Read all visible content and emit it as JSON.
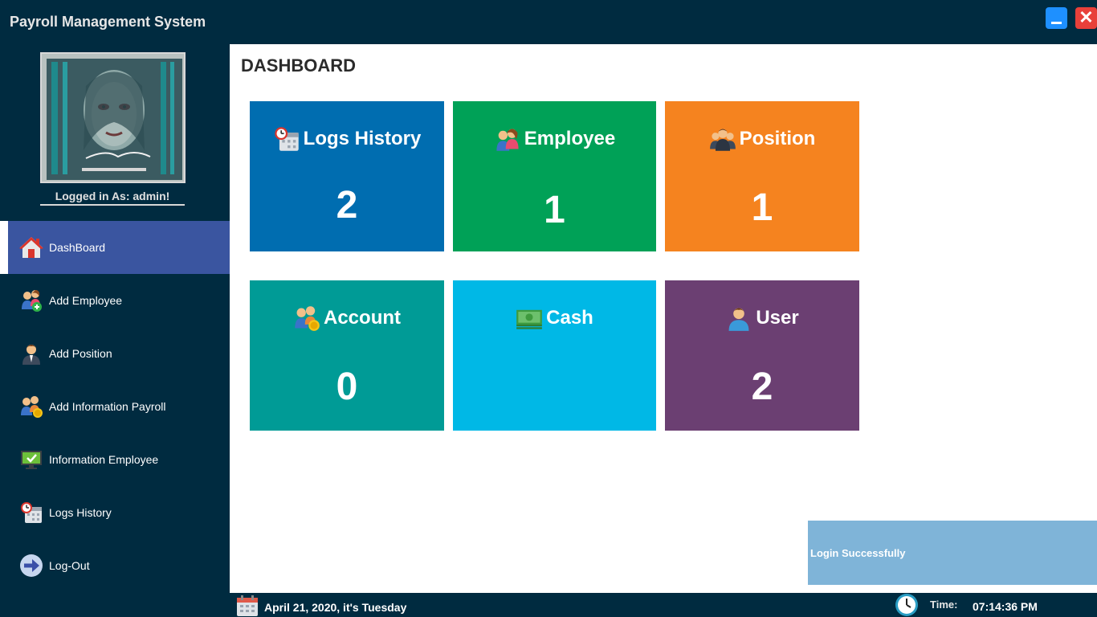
{
  "app": {
    "title": "Payroll Management System",
    "close_glyph": "✕"
  },
  "colors": {
    "background": "#002b40",
    "nav_active": "#3a55a0",
    "toast": "#7fb4d8"
  },
  "user": {
    "logged_in_text": "Logged in As: admin!"
  },
  "nav": [
    {
      "label": "DashBoard",
      "icon": "house-icon"
    },
    {
      "label": "Add Employee",
      "icon": "add-employee-icon"
    },
    {
      "label": "Add Position",
      "icon": "person-icon"
    },
    {
      "label": "Add Information Payroll",
      "icon": "payroll-icon"
    },
    {
      "label": "Information Employee",
      "icon": "monitor-icon"
    },
    {
      "label": "Logs History",
      "icon": "calendar-clock-icon"
    },
    {
      "label": "Log-Out",
      "icon": "arrow-right-icon"
    }
  ],
  "page": {
    "title": "DASHBOARD"
  },
  "cards": [
    {
      "title": "Logs History",
      "value": "2",
      "color": "#006db0",
      "icon": "calendar-clock-icon"
    },
    {
      "title": "Employee",
      "value": "1",
      "color": "#00a157",
      "icon": "employee-icon"
    },
    {
      "title": "Position",
      "value": "1",
      "color": "#f5831f",
      "icon": "group-icon"
    },
    {
      "title": "Account",
      "value": "0",
      "color": "#009b96",
      "icon": "account-icon"
    },
    {
      "title": "Cash",
      "value": "",
      "color": "#00b8e6",
      "icon": "cash-icon"
    },
    {
      "title": "User",
      "value": "2",
      "color": "#6b3f72",
      "icon": "user-icon"
    }
  ],
  "toast": {
    "message": "Login Successfully"
  },
  "status": {
    "date": "April 21, 2020, it's Tuesday",
    "time_label": "Time:",
    "time": "07:14:36 PM"
  }
}
